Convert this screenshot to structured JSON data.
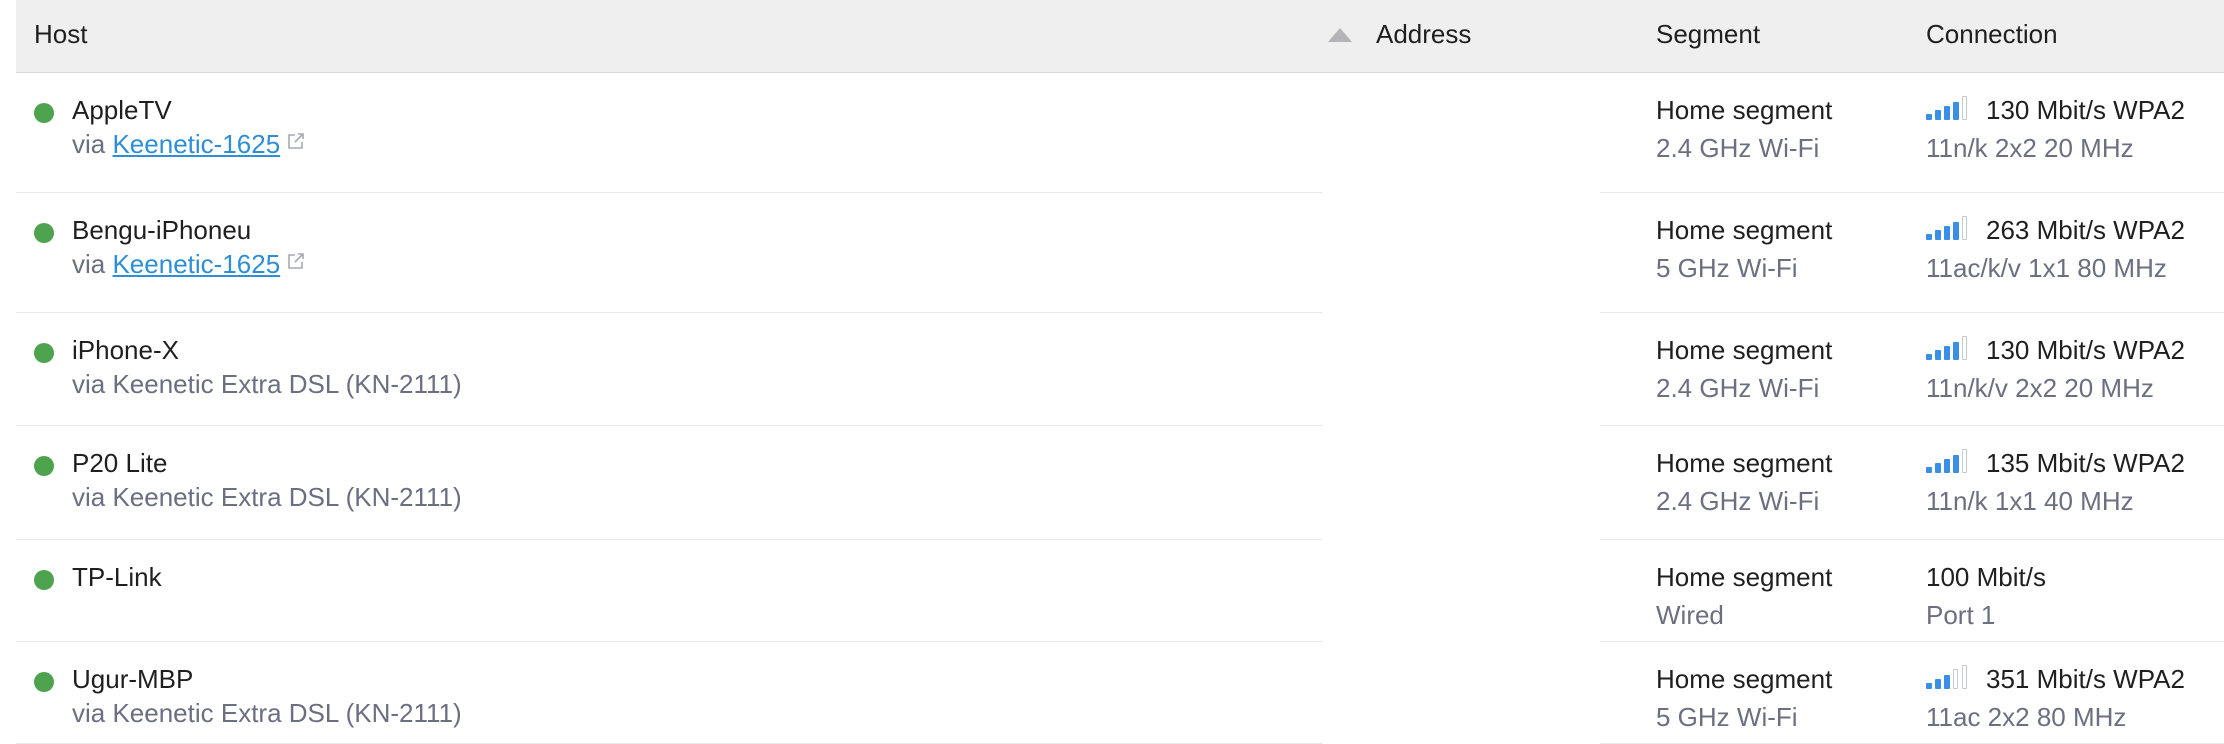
{
  "header": {
    "host": "Host",
    "address": "Address",
    "segment": "Segment",
    "connection": "Connection"
  },
  "colors": {
    "online": "#4ea34f",
    "link": "#2f8fd6",
    "signal_on": "#3a8ee6",
    "signal_off": "#c6c8cf"
  },
  "rows": [
    {
      "name": "AppleTV",
      "via_prefix": "via ",
      "via_link": "Keenetic-1625",
      "via_text": "",
      "segment": "Home segment",
      "band": "2.4 GHz Wi-Fi",
      "speed": "130 Mbit/s WPA2",
      "mode": "11n/k 2x2 20 MHz",
      "signal_bars": 4,
      "icon": "wifi-signal-icon"
    },
    {
      "name": "Bengu-iPhoneu",
      "via_prefix": "via ",
      "via_link": "Keenetic-1625",
      "via_text": "",
      "segment": "Home segment",
      "band": "5 GHz Wi-Fi",
      "speed": "263 Mbit/s WPA2",
      "mode": "11ac/k/v 1x1 80 MHz",
      "signal_bars": 4,
      "icon": "wifi-signal-icon"
    },
    {
      "name": "iPhone-X",
      "via_prefix": "",
      "via_link": "",
      "via_text": "via Keenetic Extra DSL (KN-2111)",
      "segment": "Home segment",
      "band": "2.4 GHz Wi-Fi",
      "speed": "130 Mbit/s WPA2",
      "mode": "11n/k/v 2x2 20 MHz",
      "signal_bars": 4,
      "icon": "wifi-signal-icon"
    },
    {
      "name": "P20 Lite",
      "via_prefix": "",
      "via_link": "",
      "via_text": "via Keenetic Extra DSL (KN-2111)",
      "segment": "Home segment",
      "band": "2.4 GHz Wi-Fi",
      "speed": "135 Mbit/s WPA2",
      "mode": "11n/k 1x1 40 MHz",
      "signal_bars": 4,
      "icon": "wifi-signal-icon"
    },
    {
      "name": "TP-Link",
      "via_prefix": "",
      "via_link": "",
      "via_text": "",
      "segment": "Home segment",
      "band": "Wired",
      "speed": "100 Mbit/s",
      "mode": "Port 1",
      "signal_bars": 0,
      "icon": ""
    },
    {
      "name": "Ugur-MBP",
      "via_prefix": "",
      "via_link": "",
      "via_text": "via Keenetic Extra DSL (KN-2111)",
      "segment": "Home segment",
      "band": "5 GHz Wi-Fi",
      "speed": "351 Mbit/s WPA2",
      "mode": "11ac 2x2 80 MHz",
      "signal_bars": 3,
      "icon": "wifi-signal-icon"
    }
  ]
}
